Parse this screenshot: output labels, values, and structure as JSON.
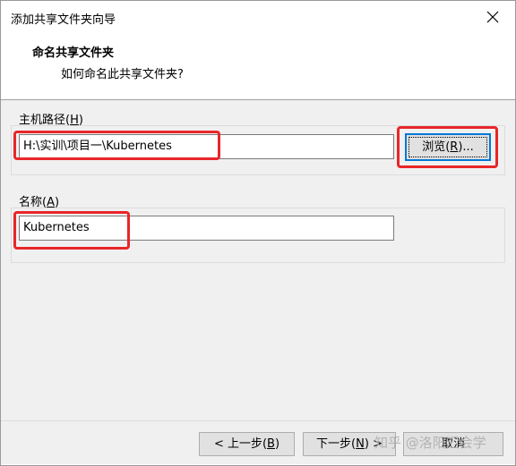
{
  "window": {
    "title": "添加共享文件夹向导"
  },
  "header": {
    "title": "命名共享文件夹",
    "subtitle": "如何命名此共享文件夹?"
  },
  "host_path": {
    "label_prefix": "主机路径(",
    "label_key": "H",
    "label_suffix": ")",
    "value": "H:\\实训\\项目一\\Kubernetes",
    "browse_prefix": "浏览(",
    "browse_key": "R",
    "browse_suffix": ")..."
  },
  "name": {
    "label_prefix": "名称(",
    "label_key": "A",
    "label_suffix": ")",
    "value": "Kubernetes"
  },
  "footer": {
    "back_prefix": "< 上一步(",
    "back_key": "B",
    "back_suffix": ")",
    "next_prefix": "下一步(",
    "next_key": "N",
    "next_suffix": ") >",
    "cancel_label": "取消"
  },
  "watermark": "知乎 @洛阳汇会学",
  "colors": {
    "highlight": "#e8262a",
    "dialog_bg": "#f0f0f0",
    "default_button_border": "#0078d7"
  }
}
